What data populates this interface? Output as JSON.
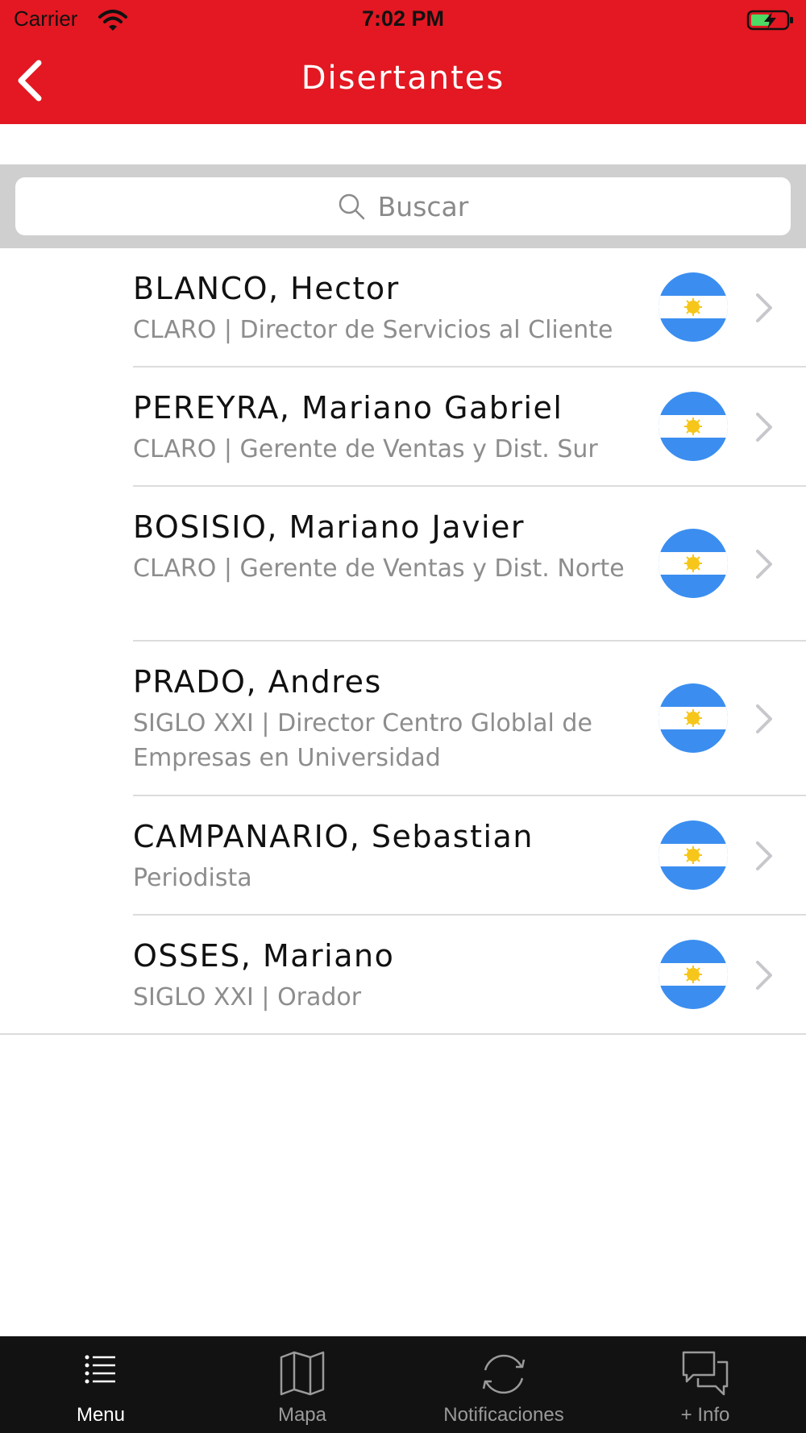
{
  "status_bar": {
    "carrier": "Carrier",
    "time": "7:02 PM"
  },
  "nav": {
    "title": "Disertantes",
    "back_icon": "chevron-left-icon"
  },
  "search": {
    "placeholder": "Buscar",
    "icon": "search-icon"
  },
  "speakers": [
    {
      "name": "BLANCO, Hector",
      "subtitle": "CLARO | Director de Servicios al Cliente",
      "flag": "argentina-flag-icon"
    },
    {
      "name": "PEREYRA, Mariano Gabriel",
      "subtitle": "CLARO | Gerente de Ventas y Dist. Sur",
      "flag": "argentina-flag-icon"
    },
    {
      "name": "BOSISIO, Mariano Javier",
      "subtitle": "CLARO | Gerente de Ventas y Dist. Norte",
      "flag": "argentina-flag-icon"
    },
    {
      "name": "PRADO, Andres",
      "subtitle": "SIGLO XXI | Director Centro Globlal de Empresas en Universidad",
      "flag": "argentina-flag-icon"
    },
    {
      "name": "CAMPANARIO, Sebastian",
      "subtitle": "Periodista",
      "flag": "argentina-flag-icon"
    },
    {
      "name": "OSSES, Mariano",
      "subtitle": "SIGLO XXI | Orador",
      "flag": "argentina-flag-icon"
    }
  ],
  "tabs": [
    {
      "label": "Menu",
      "icon": "list-icon",
      "active": true
    },
    {
      "label": "Mapa",
      "icon": "map-icon",
      "active": false
    },
    {
      "label": "Notificaciones",
      "icon": "refresh-icon",
      "active": false
    },
    {
      "label": "+ Info",
      "icon": "chat-bubbles-icon",
      "active": false
    }
  ],
  "colors": {
    "brand_red": "#e31822",
    "tab_bar": "#121212",
    "tab_active": "#ffffff",
    "tab_inactive": "#9a9a9a",
    "flag_blue": "#3b8ef0",
    "flag_sun": "#f6c61a"
  }
}
